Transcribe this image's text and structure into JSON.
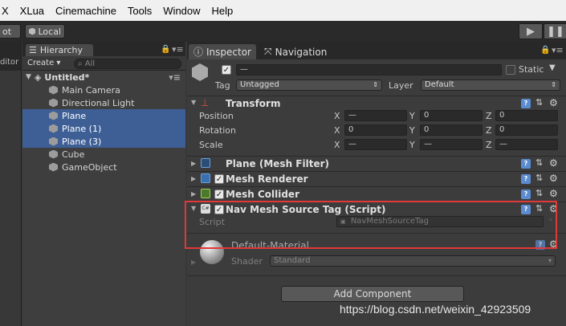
{
  "menu": [
    "X",
    "XLua",
    "Cinemachine",
    "Tools",
    "Window",
    "Help"
  ],
  "toolbar": {
    "left_frag": "ot",
    "local_label": "Local",
    "play_icon": "play-icon",
    "pause_icon": "pause-icon"
  },
  "left_panel": {
    "header_frag": "ditor"
  },
  "hierarchy": {
    "tab_label": "Hierarchy",
    "create_label": "Create ▾",
    "search_placeholder": "All",
    "scene": "Untitled*",
    "items": [
      {
        "label": "Main Camera",
        "selected": false
      },
      {
        "label": "Directional Light",
        "selected": false
      },
      {
        "label": "Plane",
        "selected": true
      },
      {
        "label": "Plane (1)",
        "selected": true
      },
      {
        "label": "Plane (3)",
        "selected": true
      },
      {
        "label": "Cube",
        "selected": false
      },
      {
        "label": "GameObject",
        "selected": false
      }
    ]
  },
  "inspector": {
    "tab_inspector": "Inspector",
    "tab_navigation": "Navigation",
    "name_value": "—",
    "static_label": "Static",
    "tag_label": "Tag",
    "tag_value": "Untagged",
    "layer_label": "Layer",
    "layer_value": "Default",
    "transform": {
      "title": "Transform",
      "position_label": "Position",
      "rotation_label": "Rotation",
      "scale_label": "Scale",
      "x": "X",
      "y": "Y",
      "z": "Z",
      "position": [
        "—",
        "0",
        "0"
      ],
      "rotation": [
        "0",
        "0",
        "0"
      ],
      "scale": [
        "—",
        "—",
        "—"
      ]
    },
    "components": [
      {
        "title": "Plane (Mesh Filter)"
      },
      {
        "title": "Mesh Renderer"
      },
      {
        "title": "Mesh Collider"
      },
      {
        "title": "Nav Mesh Source Tag (Script)"
      }
    ],
    "script_label": "Script",
    "script_value": "NavMeshSourceTag",
    "material_name": "Default-Material",
    "shader_label": "Shader",
    "shader_value": "Standard",
    "add_component": "Add Component"
  },
  "highlight_color": "#e0393a",
  "watermark": "https://blog.csdn.net/weixin_42923509"
}
